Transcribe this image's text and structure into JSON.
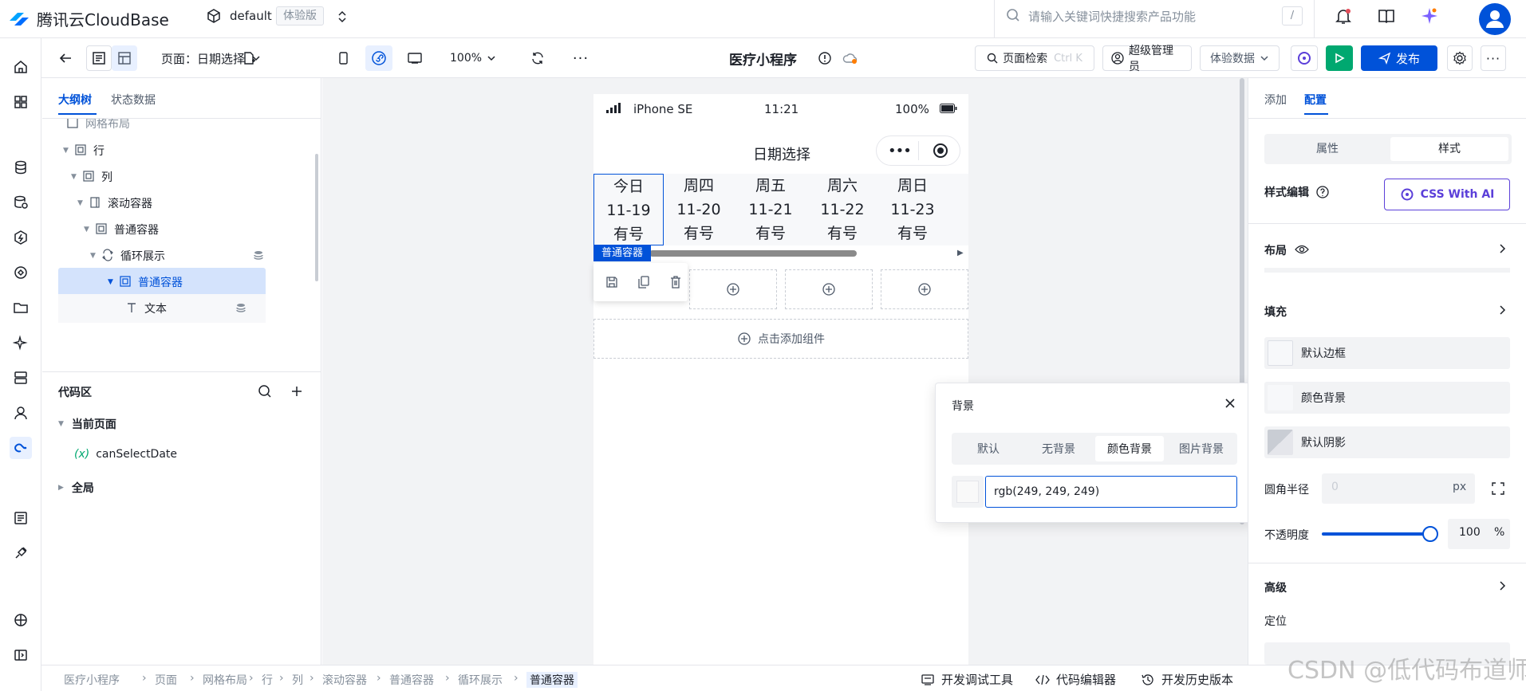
{
  "app": {
    "brand": "腾讯云CloudBase",
    "env": "default",
    "env_tag": "体验版"
  },
  "search": {
    "placeholder": "请输入关键词快捷搜索产品功能",
    "shortcut": "/"
  },
  "toolbar": {
    "page_label": "页面：日期选择",
    "zoom": "100%",
    "app_title": "医疗小程序",
    "page_search": "页面检索",
    "page_search_shortcut": "Ctrl K",
    "role": "超级管理员",
    "data_source": "体验数据",
    "publish": "发布"
  },
  "left": {
    "tabs": [
      "大纲树",
      "状态数据"
    ],
    "tree": [
      {
        "label": "网格布局",
        "indent": 0
      },
      {
        "label": "行",
        "indent": 1
      },
      {
        "label": "列",
        "indent": 2
      },
      {
        "label": "滚动容器",
        "indent": 3
      },
      {
        "label": "普通容器",
        "indent": 4
      },
      {
        "label": "循环展示",
        "indent": 5
      },
      {
        "label": "普通容器",
        "indent": 6
      },
      {
        "label": "文本",
        "indent": 7
      }
    ],
    "code_title": "代码区",
    "current_page": "当前页面",
    "var_prefix": "(x)",
    "var_name": "canSelectDate",
    "global": "全局"
  },
  "phone": {
    "carrier": "iPhone SE",
    "time": "11:21",
    "battery": "100%",
    "nav_title": "日期选择",
    "dates": [
      {
        "week": "今日",
        "date": "11-19",
        "status": "有号"
      },
      {
        "week": "周四",
        "date": "11-20",
        "status": "有号"
      },
      {
        "week": "周五",
        "date": "11-21",
        "status": "有号"
      },
      {
        "week": "周六",
        "date": "11-22",
        "status": "有号"
      },
      {
        "week": "周日",
        "date": "11-23",
        "status": "有号"
      }
    ],
    "selected_tag": "普通容器",
    "add_component": "点击添加组件"
  },
  "bg_popup": {
    "title": "背景",
    "options": [
      "默认",
      "无背景",
      "颜色背景",
      "图片背景"
    ],
    "selected": "颜色背景",
    "color_value": "rgb(249, 249, 249)"
  },
  "right": {
    "tabs": [
      "添加",
      "配置"
    ],
    "seg": [
      "属性",
      "样式"
    ],
    "style_edit": "样式编辑",
    "css_ai": "CSS With AI",
    "layout": "布局",
    "fill": "填充",
    "fill_items": [
      "默认边框",
      "颜色背景",
      "默认阴影"
    ],
    "radius_label": "圆角半径",
    "radius_value": "0",
    "radius_unit": "px",
    "opacity_label": "不透明度",
    "opacity_value": "100",
    "opacity_unit": "%",
    "opacity_level": 1.0,
    "advanced": "高级",
    "position": "定位"
  },
  "bottom": {
    "breadcrumb": [
      "医疗小程序",
      "页面",
      "网格布局",
      "行",
      "列",
      "滚动容器",
      "普通容器",
      "循环展示",
      "普通容器"
    ],
    "tools": [
      "开发调试工具",
      "代码编辑器",
      "开发历史版本"
    ]
  },
  "watermark": "CSDN @低代码布道师",
  "colors": {
    "accent": "#0052d9",
    "run": "#00a870"
  }
}
